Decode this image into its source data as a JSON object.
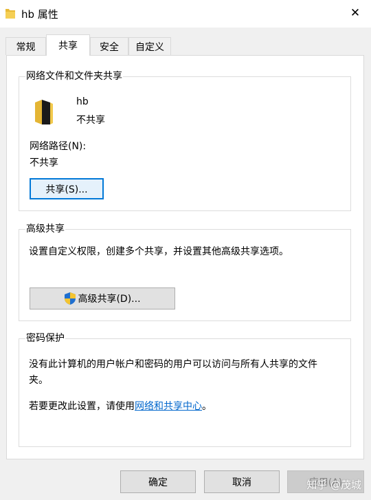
{
  "window": {
    "title": "hb 属性",
    "close_label": "✕"
  },
  "tabs": [
    "常规",
    "共享",
    "安全",
    "自定义"
  ],
  "share_group": {
    "title": "网络文件和文件夹共享",
    "folder_name": "hb",
    "folder_status": "不共享",
    "path_label": "网络路径(N):",
    "path_value": "不共享",
    "share_button": "共享(S)..."
  },
  "advanced_group": {
    "title": "高级共享",
    "description": "设置自定义权限，创建多个共享，并设置其他高级共享选项。",
    "button": "高级共享(D)..."
  },
  "password_group": {
    "title": "密码保护",
    "description_line1": "没有此计算机的用户帐户和密码的用户可以访问与所有人共享的文件",
    "description_line2": "夹。",
    "change_prefix": "若要更改此设置，请使用",
    "change_link": "网络和共享中心",
    "change_suffix": "。"
  },
  "footer": {
    "ok": "确定",
    "cancel": "取消",
    "apply": "应用(A)"
  },
  "watermark": "知乎 @茂城",
  "colors": {
    "accent": "#0078d7",
    "link": "#0066cc",
    "folder": "#f0c040"
  }
}
